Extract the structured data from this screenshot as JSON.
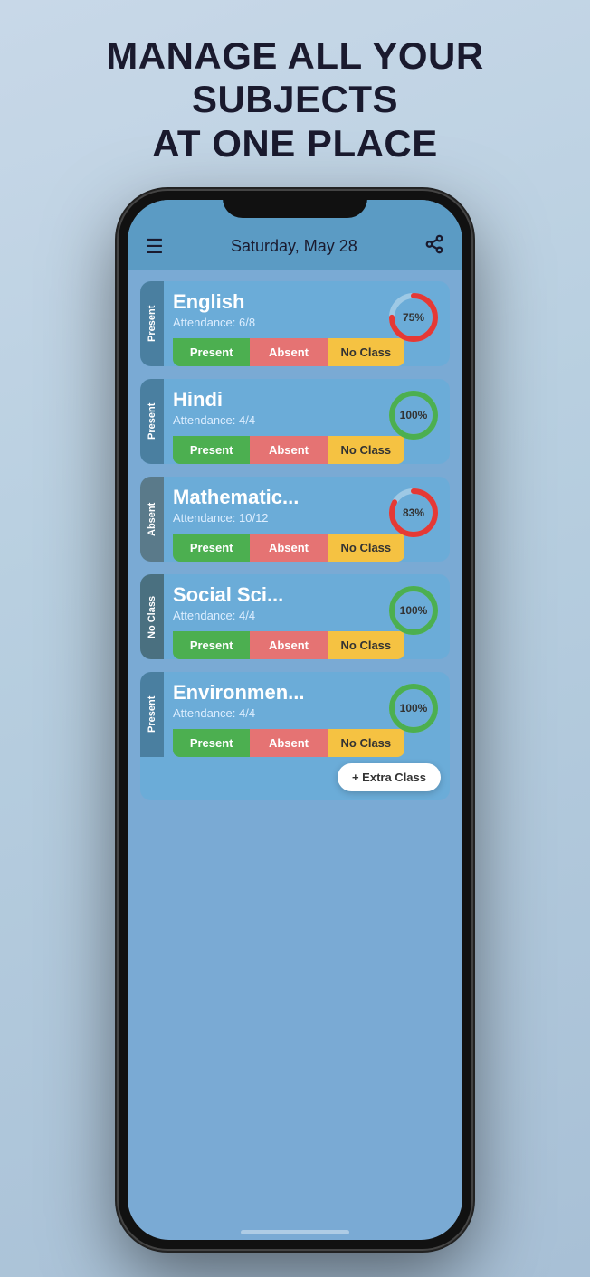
{
  "page": {
    "title_line1": "MANAGE ALL YOUR",
    "title_line2": "SUBJECTS",
    "title_line3": "AT ONE PLACE"
  },
  "header": {
    "date": "Saturday, May 28",
    "menu_label": "☰",
    "share_label": "⋮"
  },
  "subjects": [
    {
      "id": "english",
      "name": "English",
      "attendance_text": "Attendance: 6/8",
      "percentage": 75,
      "percentage_label": "75%",
      "status": "present",
      "status_label": "Present",
      "color_type": "partial",
      "btn_present": "Present",
      "btn_absent": "Absent",
      "btn_noclass": "No Class"
    },
    {
      "id": "hindi",
      "name": "Hindi",
      "attendance_text": "Attendance: 4/4",
      "percentage": 100,
      "percentage_label": "100%",
      "status": "present",
      "status_label": "Present",
      "color_type": "full",
      "btn_present": "Present",
      "btn_absent": "Absent",
      "btn_noclass": "No Class"
    },
    {
      "id": "math",
      "name": "Mathematic...",
      "attendance_text": "Attendance: 10/12",
      "percentage": 83,
      "percentage_label": "83%",
      "status": "absent",
      "status_label": "Absent",
      "color_type": "partial",
      "btn_present": "Present",
      "btn_absent": "Absent",
      "btn_noclass": "No Class"
    },
    {
      "id": "social",
      "name": "Social Sci...",
      "attendance_text": "Attendance: 4/4",
      "percentage": 100,
      "percentage_label": "100%",
      "status": "noclass",
      "status_label": "No Class",
      "color_type": "full",
      "btn_present": "Present",
      "btn_absent": "Absent",
      "btn_noclass": "No Class"
    },
    {
      "id": "environment",
      "name": "Environmen...",
      "attendance_text": "Attendance: 4/4",
      "percentage": 100,
      "percentage_label": "100%",
      "status": "present",
      "status_label": "Present",
      "color_type": "full",
      "btn_present": "Present",
      "btn_absent": "Absent",
      "btn_noclass": "No Class",
      "has_extra": true,
      "extra_label": "+ Extra Class"
    }
  ],
  "colors": {
    "present_tab": "#4a7fa0",
    "absent_tab": "#5a7a8a",
    "noclass_tab": "#4a7080",
    "btn_present": "#4caf50",
    "btn_absent": "#e57373",
    "btn_noclass": "#f5c242",
    "donut_full": "#4caf50",
    "donut_partial_fg": "#e53935",
    "donut_bg": "rgba(255,255,255,0.4)"
  }
}
